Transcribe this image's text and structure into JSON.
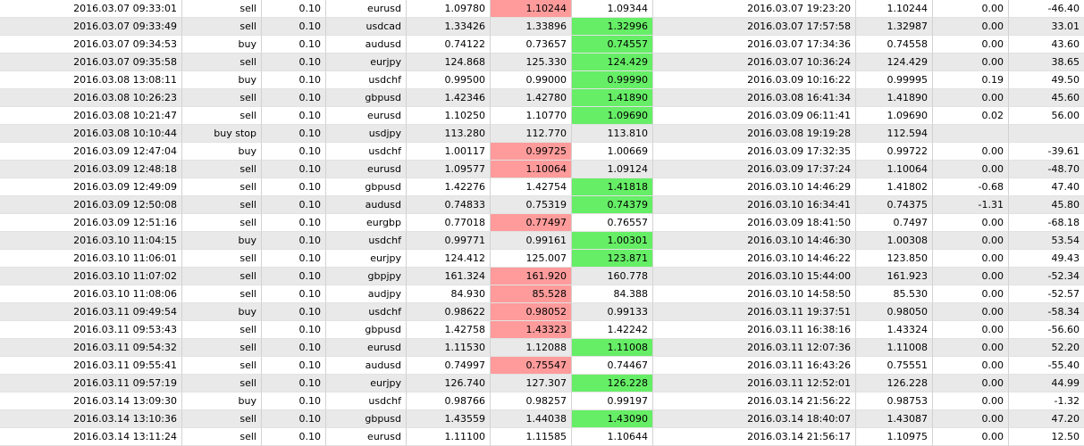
{
  "colors": {
    "sl_hit": "#ff9b9b",
    "tp_hit": "#66ee66",
    "row_alt": "#e9e9e9"
  },
  "rows": [
    {
      "open": "2016.03.07 09:33:01",
      "type": "sell",
      "size": "0.10",
      "symbol": "eurusd",
      "price": "1.09780",
      "sl": "1.10244",
      "tp": "1.09344",
      "close_time": "2016.03.07 19:23:20",
      "close_price": "1.10244",
      "commission": "0.00",
      "profit": "-46.40",
      "hl": "sl"
    },
    {
      "open": "2016.03.07 09:33:49",
      "type": "sell",
      "size": "0.10",
      "symbol": "usdcad",
      "price": "1.33426",
      "sl": "1.33896",
      "tp": "1.32996",
      "close_time": "2016.03.07 17:57:58",
      "close_price": "1.32987",
      "commission": "0.00",
      "profit": "33.01",
      "hl": "tp"
    },
    {
      "open": "2016.03.07 09:34:53",
      "type": "buy",
      "size": "0.10",
      "symbol": "audusd",
      "price": "0.74122",
      "sl": "0.73657",
      "tp": "0.74557",
      "close_time": "2016.03.07 17:34:36",
      "close_price": "0.74558",
      "commission": "0.00",
      "profit": "43.60",
      "hl": "tp"
    },
    {
      "open": "2016.03.07 09:35:58",
      "type": "sell",
      "size": "0.10",
      "symbol": "eurjpy",
      "price": "124.868",
      "sl": "125.330",
      "tp": "124.429",
      "close_time": "2016.03.07 10:36:24",
      "close_price": "124.429",
      "commission": "0.00",
      "profit": "38.65",
      "hl": "tp"
    },
    {
      "open": "2016.03.08 13:08:11",
      "type": "buy",
      "size": "0.10",
      "symbol": "usdchf",
      "price": "0.99500",
      "sl": "0.99000",
      "tp": "0.99990",
      "close_time": "2016.03.09 10:16:22",
      "close_price": "0.99995",
      "commission": "0.19",
      "profit": "49.50",
      "hl": "tp"
    },
    {
      "open": "2016.03.08 10:26:23",
      "type": "sell",
      "size": "0.10",
      "symbol": "gbpusd",
      "price": "1.42346",
      "sl": "1.42780",
      "tp": "1.41890",
      "close_time": "2016.03.08 16:41:34",
      "close_price": "1.41890",
      "commission": "0.00",
      "profit": "45.60",
      "hl": "tp"
    },
    {
      "open": "2016.03.08 10:21:47",
      "type": "sell",
      "size": "0.10",
      "symbol": "eurusd",
      "price": "1.10250",
      "sl": "1.10770",
      "tp": "1.09690",
      "close_time": "2016.03.09 06:11:41",
      "close_price": "1.09690",
      "commission": "0.02",
      "profit": "56.00",
      "hl": "tp"
    },
    {
      "open": "2016.03.08 10:10:44",
      "type": "buy stop",
      "size": "0.10",
      "symbol": "usdjpy",
      "price": "113.280",
      "sl": "112.770",
      "tp": "113.810",
      "close_time": "2016.03.08 19:19:28",
      "close_price": "112.594",
      "commission": "",
      "profit": "",
      "hl": ""
    },
    {
      "open": "2016.03.09 12:47:04",
      "type": "buy",
      "size": "0.10",
      "symbol": "usdchf",
      "price": "1.00117",
      "sl": "0.99725",
      "tp": "1.00669",
      "close_time": "2016.03.09 17:32:35",
      "close_price": "0.99722",
      "commission": "0.00",
      "profit": "-39.61",
      "hl": "sl"
    },
    {
      "open": "2016.03.09 12:48:18",
      "type": "sell",
      "size": "0.10",
      "symbol": "eurusd",
      "price": "1.09577",
      "sl": "1.10064",
      "tp": "1.09124",
      "close_time": "2016.03.09 17:37:24",
      "close_price": "1.10064",
      "commission": "0.00",
      "profit": "-48.70",
      "hl": "sl"
    },
    {
      "open": "2016.03.09 12:49:09",
      "type": "sell",
      "size": "0.10",
      "symbol": "gbpusd",
      "price": "1.42276",
      "sl": "1.42754",
      "tp": "1.41818",
      "close_time": "2016.03.10 14:46:29",
      "close_price": "1.41802",
      "commission": "-0.68",
      "profit": "47.40",
      "hl": "tp"
    },
    {
      "open": "2016.03.09 12:50:08",
      "type": "sell",
      "size": "0.10",
      "symbol": "audusd",
      "price": "0.74833",
      "sl": "0.75319",
      "tp": "0.74379",
      "close_time": "2016.03.10 16:34:41",
      "close_price": "0.74375",
      "commission": "-1.31",
      "profit": "45.80",
      "hl": "tp"
    },
    {
      "open": "2016.03.09 12:51:16",
      "type": "sell",
      "size": "0.10",
      "symbol": "eurgbp",
      "price": "0.77018",
      "sl": "0.77497",
      "tp": "0.76557",
      "close_time": "2016.03.09 18:41:50",
      "close_price": "0.7497",
      "commission": "0.00",
      "profit": "-68.18",
      "hl": "sl"
    },
    {
      "open": "2016.03.10 11:04:15",
      "type": "buy",
      "size": "0.10",
      "symbol": "usdchf",
      "price": "0.99771",
      "sl": "0.99161",
      "tp": "1.00301",
      "close_time": "2016.03.10 14:46:30",
      "close_price": "1.00308",
      "commission": "0.00",
      "profit": "53.54",
      "hl": "tp"
    },
    {
      "open": "2016.03.10 11:06:01",
      "type": "sell",
      "size": "0.10",
      "symbol": "eurjpy",
      "price": "124.412",
      "sl": "125.007",
      "tp": "123.871",
      "close_time": "2016.03.10 14:46:22",
      "close_price": "123.850",
      "commission": "0.00",
      "profit": "49.43",
      "hl": "tp"
    },
    {
      "open": "2016.03.10 11:07:02",
      "type": "sell",
      "size": "0.10",
      "symbol": "gbpjpy",
      "price": "161.324",
      "sl": "161.920",
      "tp": "160.778",
      "close_time": "2016.03.10 15:44:00",
      "close_price": "161.923",
      "commission": "0.00",
      "profit": "-52.34",
      "hl": "sl"
    },
    {
      "open": "2016.03.10 11:08:06",
      "type": "sell",
      "size": "0.10",
      "symbol": "audjpy",
      "price": "84.930",
      "sl": "85.528",
      "tp": "84.388",
      "close_time": "2016.03.10 14:58:50",
      "close_price": "85.530",
      "commission": "0.00",
      "profit": "-52.57",
      "hl": "sl"
    },
    {
      "open": "2016.03.11 09:49:54",
      "type": "buy",
      "size": "0.10",
      "symbol": "usdchf",
      "price": "0.98622",
      "sl": "0.98052",
      "tp": "0.99133",
      "close_time": "2016.03.11 19:37:51",
      "close_price": "0.98050",
      "commission": "0.00",
      "profit": "-58.34",
      "hl": "sl"
    },
    {
      "open": "2016.03.11 09:53:43",
      "type": "sell",
      "size": "0.10",
      "symbol": "gbpusd",
      "price": "1.42758",
      "sl": "1.43323",
      "tp": "1.42242",
      "close_time": "2016.03.11 16:38:16",
      "close_price": "1.43324",
      "commission": "0.00",
      "profit": "-56.60",
      "hl": "sl"
    },
    {
      "open": "2016.03.11 09:54:32",
      "type": "sell",
      "size": "0.10",
      "symbol": "eurusd",
      "price": "1.11530",
      "sl": "1.12088",
      "tp": "1.11008",
      "close_time": "2016.03.11 12:07:36",
      "close_price": "1.11008",
      "commission": "0.00",
      "profit": "52.20",
      "hl": "tp"
    },
    {
      "open": "2016.03.11 09:55:41",
      "type": "sell",
      "size": "0.10",
      "symbol": "audusd",
      "price": "0.74997",
      "sl": "0.75547",
      "tp": "0.74467",
      "close_time": "2016.03.11 16:43:26",
      "close_price": "0.75551",
      "commission": "0.00",
      "profit": "-55.40",
      "hl": "sl"
    },
    {
      "open": "2016.03.11 09:57:19",
      "type": "sell",
      "size": "0.10",
      "symbol": "eurjpy",
      "price": "126.740",
      "sl": "127.307",
      "tp": "126.228",
      "close_time": "2016.03.11 12:52:01",
      "close_price": "126.228",
      "commission": "0.00",
      "profit": "44.99",
      "hl": "tp"
    },
    {
      "open": "2016.03.14 13:09:30",
      "type": "buy",
      "size": "0.10",
      "symbol": "usdchf",
      "price": "0.98766",
      "sl": "0.98257",
      "tp": "0.99197",
      "close_time": "2016.03.14 21:56:22",
      "close_price": "0.98753",
      "commission": "0.00",
      "profit": "-1.32",
      "hl": ""
    },
    {
      "open": "2016.03.14 13:10:36",
      "type": "sell",
      "size": "0.10",
      "symbol": "gbpusd",
      "price": "1.43559",
      "sl": "1.44038",
      "tp": "1.43090",
      "close_time": "2016.03.14 18:40:07",
      "close_price": "1.43087",
      "commission": "0.00",
      "profit": "47.20",
      "hl": "tp"
    },
    {
      "open": "2016.03.14 13:11:24",
      "type": "sell",
      "size": "0.10",
      "symbol": "eurusd",
      "price": "1.11100",
      "sl": "1.11585",
      "tp": "1.10644",
      "close_time": "2016.03.14 21:56:17",
      "close_price": "1.10975",
      "commission": "0.00",
      "profit": "12.50",
      "hl": ""
    }
  ]
}
